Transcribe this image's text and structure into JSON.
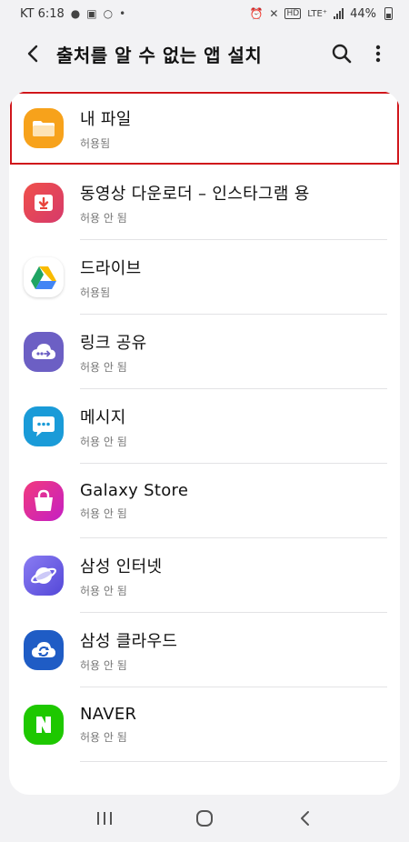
{
  "status_bar": {
    "carrier_time": "KT 6:18",
    "network": "LTE⁺",
    "battery": "44%"
  },
  "app_bar": {
    "title": "출처를 알 수 없는 앱 설치"
  },
  "apps": [
    {
      "name": "내 파일",
      "status": "허용됨",
      "icon": "folder-icon",
      "color": "#f7a21b"
    },
    {
      "name": "동영상 다운로더 – 인스타그램 용",
      "status": "허용 안 됨",
      "icon": "download-icon",
      "color": "#e8443b"
    },
    {
      "name": "드라이브",
      "status": "허용됨",
      "icon": "google-drive-icon",
      "color": "#ffffff"
    },
    {
      "name": "링크 공유",
      "status": "허용 안 됨",
      "icon": "cloud-share-icon",
      "color": "#6c5fc4"
    },
    {
      "name": "메시지",
      "status": "허용 안 됨",
      "icon": "chat-bubble-icon",
      "color": "#1a9bd8"
    },
    {
      "name": "Galaxy Store",
      "status": "허용 안 됨",
      "icon": "shopping-bag-icon",
      "color": "#e8307a"
    },
    {
      "name": "삼성 인터넷",
      "status": "허용 안 됨",
      "icon": "planet-icon",
      "color": "#6d63e8"
    },
    {
      "name": "삼성 클라우드",
      "status": "허용 안 됨",
      "icon": "cloud-sync-icon",
      "color": "#1f5cc5"
    },
    {
      "name": "NAVER",
      "status": "허용 안 됨",
      "icon": "naver-n-icon",
      "color": "#1ec800"
    }
  ],
  "highlight_color": "#d0161b"
}
